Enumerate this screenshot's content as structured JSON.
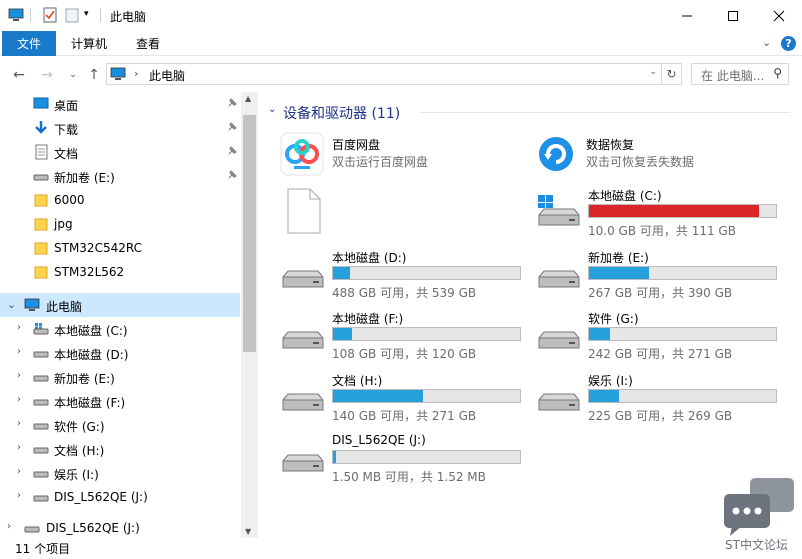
{
  "window": {
    "title": "此电脑"
  },
  "ribbon": {
    "tabs": [
      "文件",
      "计算机",
      "查看"
    ]
  },
  "address": {
    "path": "此电脑",
    "search_placeholder": "在 此电脑..."
  },
  "nav": {
    "quick_access": [
      {
        "label": "桌面",
        "icon": "desktop-icon",
        "pinned": true
      },
      {
        "label": "下载",
        "icon": "download-icon",
        "pinned": true
      },
      {
        "label": "文档",
        "icon": "document-icon",
        "pinned": true
      },
      {
        "label": "新加卷 (E:)",
        "icon": "drive-icon",
        "pinned": true
      },
      {
        "label": "6000",
        "icon": "folder-icon",
        "pinned": false
      },
      {
        "label": "jpg",
        "icon": "folder-icon",
        "pinned": false
      },
      {
        "label": "STM32C542RC",
        "icon": "folder-icon",
        "pinned": false
      },
      {
        "label": "STM32L562",
        "icon": "folder-icon",
        "pinned": false
      }
    ],
    "this_pc": "此电脑",
    "drives": [
      {
        "label": "本地磁盘 (C:)",
        "icon": "windows-drive-icon"
      },
      {
        "label": "本地磁盘 (D:)",
        "icon": "drive-icon"
      },
      {
        "label": "新加卷 (E:)",
        "icon": "drive-icon"
      },
      {
        "label": "本地磁盘 (F:)",
        "icon": "drive-icon"
      },
      {
        "label": "软件 (G:)",
        "icon": "drive-icon"
      },
      {
        "label": "文档 (H:)",
        "icon": "drive-icon"
      },
      {
        "label": "娱乐 (I:)",
        "icon": "drive-icon"
      },
      {
        "label": "DIS_L562QE (J:)",
        "icon": "drive-icon"
      }
    ],
    "external": "DIS_L562QE (J:)"
  },
  "content": {
    "section_title": "设备和驱动器 (11)",
    "apps": [
      {
        "name": "百度网盘",
        "sub": "双击运行百度网盘",
        "icon": "baidu-netdisk-icon"
      },
      {
        "name": "数据恢复",
        "sub": "双击可恢复丢失数据",
        "icon": "data-recovery-icon"
      }
    ],
    "drives": [
      {
        "name": "本地磁盘 (C:)",
        "free": "10.0 GB 可用，共 111 GB",
        "used_fraction": 0.91,
        "color": "#da2626"
      },
      {
        "name": "本地磁盘 (D:)",
        "free": "488 GB 可用，共 539 GB",
        "used_fraction": 0.09,
        "color": "#26a0da"
      },
      {
        "name": "新加卷 (E:)",
        "free": "267 GB 可用，共 390 GB",
        "used_fraction": 0.32,
        "color": "#26a0da"
      },
      {
        "name": "本地磁盘 (F:)",
        "free": "108 GB 可用，共 120 GB",
        "used_fraction": 0.1,
        "color": "#26a0da"
      },
      {
        "name": "软件 (G:)",
        "free": "242 GB 可用，共 271 GB",
        "used_fraction": 0.11,
        "color": "#26a0da"
      },
      {
        "name": "文档 (H:)",
        "free": "140 GB 可用，共 271 GB",
        "used_fraction": 0.48,
        "color": "#26a0da"
      },
      {
        "name": "娱乐 (I:)",
        "free": "225 GB 可用，共 269 GB",
        "used_fraction": 0.16,
        "color": "#26a0da"
      },
      {
        "name": "DIS_L562QE (J:)",
        "free": "1.50 MB 可用，共 1.52 MB",
        "used_fraction": 0.015,
        "color": "#26a0da"
      }
    ]
  },
  "status": {
    "count": "11 个项目"
  },
  "watermark": {
    "text": "ST中文论坛"
  }
}
